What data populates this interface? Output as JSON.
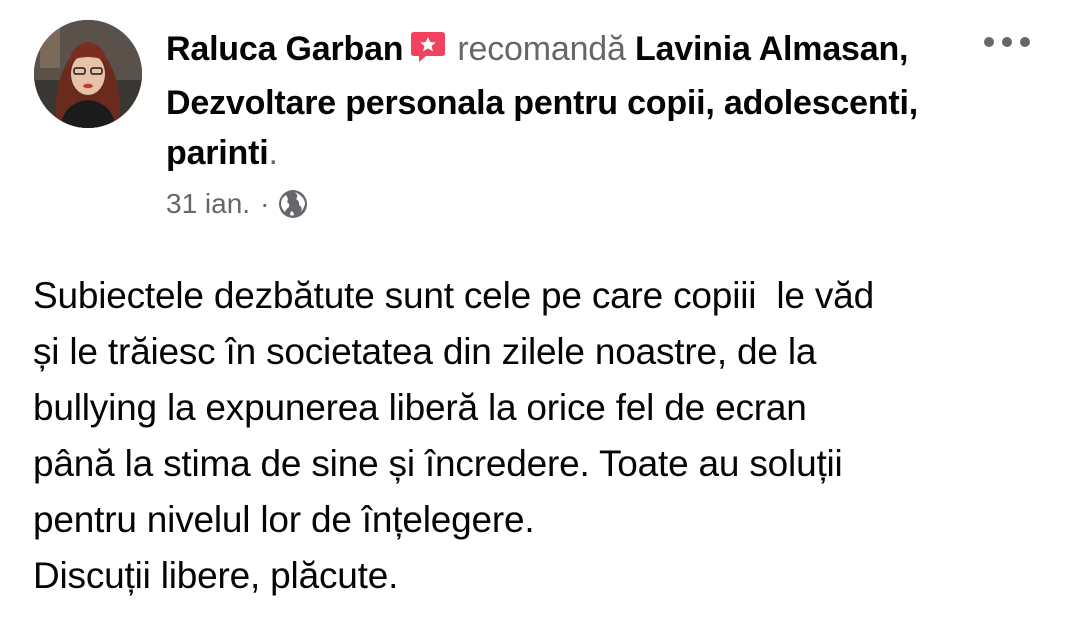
{
  "post": {
    "author": "Raluca Garban",
    "action": "recomandă",
    "page": "Lavinia Almasan, Dezvoltare personala pentru copii, adolescenti, parinti",
    "period": ".",
    "date": "31 ian.",
    "separator": "·",
    "privacy_icon": "globe-icon",
    "recommend_icon": "recommend-icon",
    "recommend_icon_color": "#f3425f",
    "more_icon": "more-dots-icon",
    "body_lines": [
      "Subiectele dezbătute sunt cele pe care copiii  le văd",
      "și le trăiesc în societatea din zilele noastre, de la",
      "bullying la expunerea liberă la orice fel de ecran",
      "până la stima de sine și încredere. Toate au soluții",
      "pentru nivelul lor de înțelegere.",
      "Discuții libere, plăcute."
    ]
  },
  "colors": {
    "primary_text": "#050505",
    "secondary_text": "#65676b",
    "background": "#ffffff"
  }
}
